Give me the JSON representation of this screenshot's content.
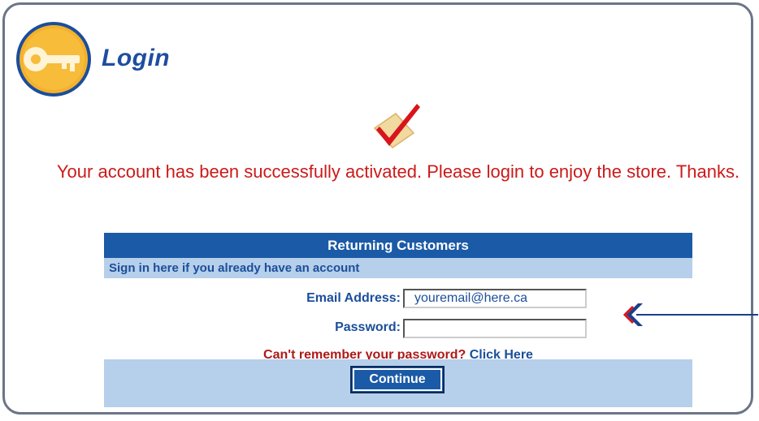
{
  "header": {
    "title": "Login",
    "logo_icon": "key-icon"
  },
  "status": {
    "icon": "checkmark-icon",
    "message": "Your account has been successfully activated. Please login to enjoy the store. Thanks."
  },
  "login_panel": {
    "title": "Returning Customers",
    "subtitle": "Sign in here if you already have an account",
    "email_label": "Email Address:",
    "email_value": "youremail@here.ca",
    "password_label": "Password:",
    "password_value": "",
    "forgot_text": "Can't remember your password?",
    "forgot_link": "Click Here",
    "continue_label": "Continue"
  },
  "colors": {
    "accent": "#1b5aa6",
    "message": "#cc1a1a",
    "panel_light": "#b6cfea",
    "frame": "#6b7587"
  }
}
